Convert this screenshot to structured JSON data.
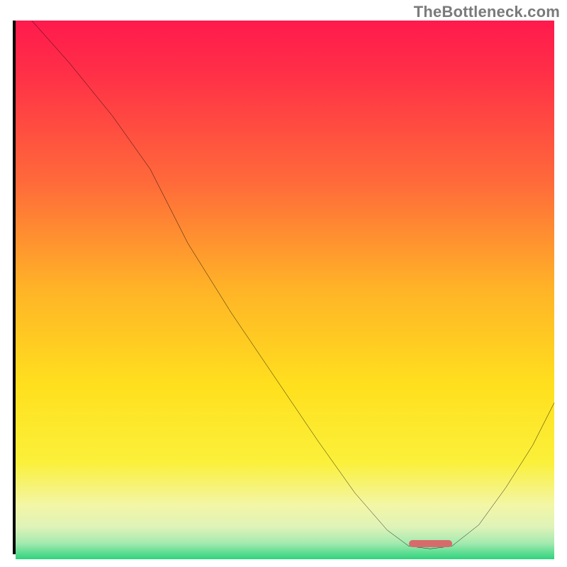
{
  "watermark": "TheBottleneck.com",
  "chart_data": {
    "type": "line",
    "title": "",
    "xlabel": "",
    "ylabel": "",
    "xlim": [
      0,
      100
    ],
    "ylim": [
      0,
      100
    ],
    "grid": false,
    "legend": false,
    "gradient_stops": [
      {
        "offset": 0.0,
        "color": "#ff1a4d"
      },
      {
        "offset": 0.1,
        "color": "#ff3047"
      },
      {
        "offset": 0.3,
        "color": "#ff6a3a"
      },
      {
        "offset": 0.5,
        "color": "#ffb427"
      },
      {
        "offset": 0.68,
        "color": "#ffe01e"
      },
      {
        "offset": 0.82,
        "color": "#fbf03a"
      },
      {
        "offset": 0.9,
        "color": "#f3f6a6"
      },
      {
        "offset": 0.94,
        "color": "#dff3b8"
      },
      {
        "offset": 0.97,
        "color": "#a5eab0"
      },
      {
        "offset": 1.0,
        "color": "#2fd47d"
      }
    ],
    "series": [
      {
        "name": "bottleneck-curve",
        "color": "#000000",
        "x": [
          3,
          10,
          18,
          25,
          32,
          40,
          48,
          56,
          63,
          69,
          73,
          77,
          81,
          86,
          91,
          96,
          100
        ],
        "y": [
          100,
          92,
          82,
          72,
          58,
          45,
          33,
          21,
          11,
          4,
          1,
          0.5,
          1,
          5,
          12,
          20,
          28
        ]
      }
    ],
    "marker": {
      "name": "optimal-range",
      "x_start": 73,
      "x_end": 81,
      "y": 0.8,
      "color": "#d76b6b"
    }
  }
}
